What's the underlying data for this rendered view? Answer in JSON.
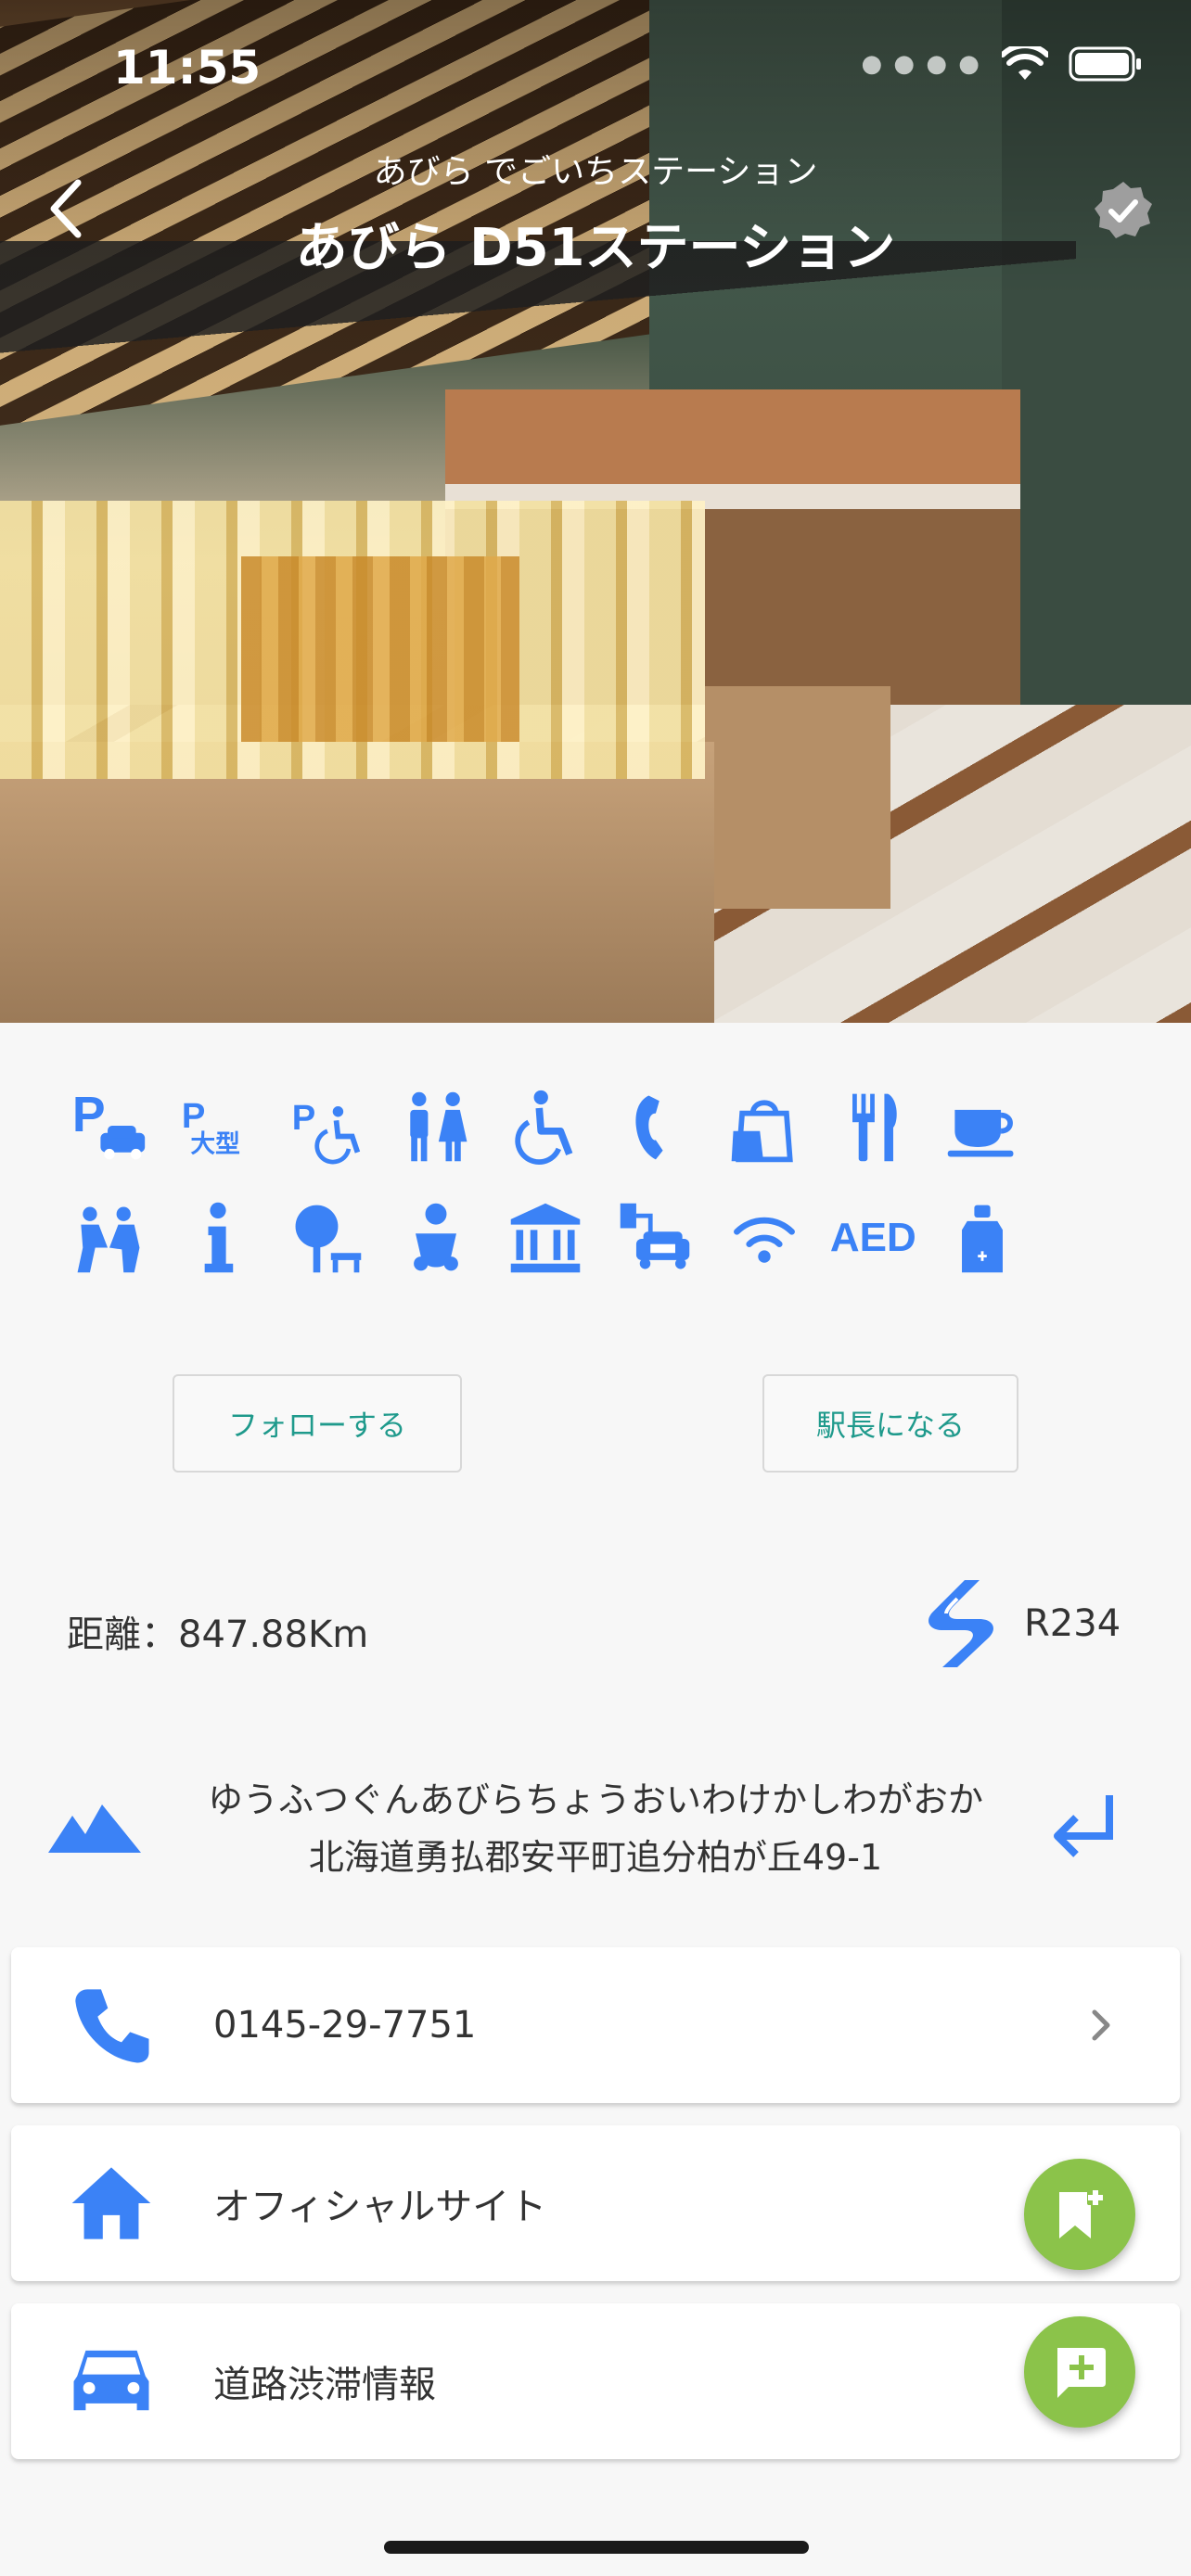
{
  "status_bar": {
    "time": "11:55"
  },
  "header": {
    "subtitle": "あびら でごいちステーション",
    "title": "あびら D51ステーション"
  },
  "amenities": {
    "row1": [
      "parking-icon",
      "large-vehicle-parking-icon",
      "accessible-parking-icon",
      "restroom-icon",
      "wheelchair-icon",
      "phone-icon",
      "shopping-icon",
      "restaurant-icon",
      "cafe-icon"
    ],
    "row2": [
      "rest-area-icon",
      "information-icon",
      "park-icon",
      "baby-care-icon",
      "museum-icon",
      "ev-charger-icon",
      "wifi-icon",
      "aed-icon",
      "first-aid-icon"
    ],
    "aed_label": "AED",
    "parking_large_label": "大型"
  },
  "actions": {
    "follow_label": "フォローする",
    "station_master_label": "駅長になる"
  },
  "distance": {
    "text": "距離：847.88Km"
  },
  "route": {
    "label": "R234"
  },
  "address": {
    "kana": "ゆうふつぐんあびらちょうおいわけかしわがおか",
    "text": "北海道勇払郡安平町追分柏が丘49-1"
  },
  "cards": {
    "phone": "0145-29-7751",
    "official_site": "オフィシャルサイト",
    "traffic": "道路渋滞情報"
  },
  "colors": {
    "accent": "#3b82f6",
    "button_text": "#1f9a8c",
    "fab": "#8bc34a",
    "background": "#f7f7f7"
  }
}
